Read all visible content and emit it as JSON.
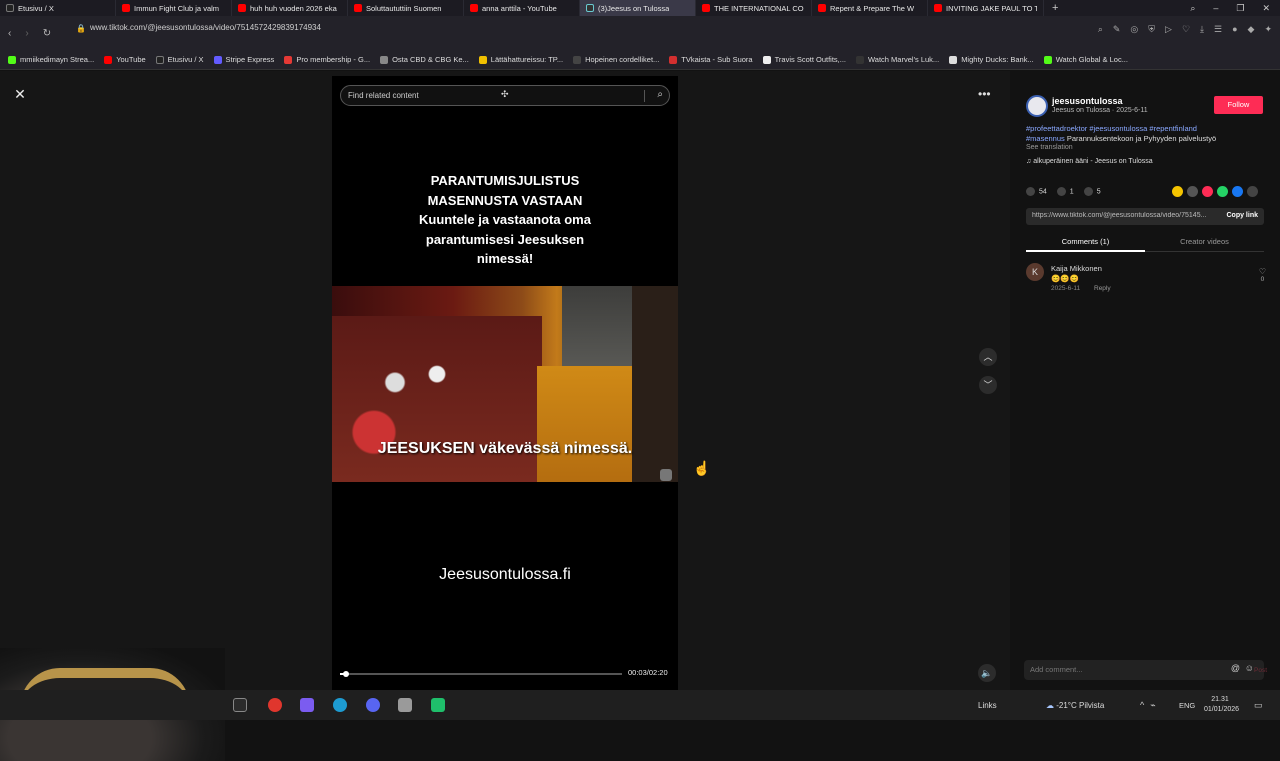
{
  "browser": {
    "tabs": [
      {
        "title": "Etusivu / X",
        "color": "#222222"
      },
      {
        "title": "Immun Fight Club ja valm",
        "color": "#ff0000"
      },
      {
        "title": "huh huh vuoden 2026 eka",
        "color": "#ff0000"
      },
      {
        "title": "Soluttaututtiin Suomen",
        "color": "#ff0000"
      },
      {
        "title": "anna anttila - YouTube",
        "color": "#ff0000"
      },
      {
        "title": "(3)Jeesus on Tulossa",
        "color": "#333333",
        "active": true
      },
      {
        "title": "THE INTERNATIONAL CO",
        "color": "#ff0000"
      },
      {
        "title": "Repent & Prepare The W",
        "color": "#ff0000"
      },
      {
        "title": "INVITING JAKE PAUL TO T",
        "color": "#ff0000"
      }
    ],
    "new_tab_label": "+",
    "url": "www.tiktok.com/@jeesusontulossa/video/7514572429839174934",
    "bookmarks": [
      {
        "label": "mmiikedimayn Strea...",
        "color": "#53fc18"
      },
      {
        "label": "YouTube",
        "color": "#ff0000"
      },
      {
        "label": "Etusivu / X",
        "color": "#222222"
      },
      {
        "label": "Stripe Express",
        "color": "#635bff"
      },
      {
        "label": "Pro membership - G...",
        "color": "#e53935"
      },
      {
        "label": "Osta CBD & CBG Ke...",
        "color": "#888888"
      },
      {
        "label": "Lättähattureissu: TP...",
        "color": "#f0c000"
      },
      {
        "label": "Hopeinen cordelliket...",
        "color": "#444444"
      },
      {
        "label": "TVkaista - Sub Suora",
        "color": "#d32f2f"
      },
      {
        "label": "Travis Scott Outfits,...",
        "color": "#eeeeee"
      },
      {
        "label": "Watch Marvel's Luk...",
        "color": "#333333"
      },
      {
        "label": "Mighty Ducks: Bank...",
        "color": "#dddddd"
      },
      {
        "label": "Watch Global & Loc...",
        "color": "#53fc18"
      }
    ]
  },
  "video": {
    "search_placeholder": "Find related content",
    "top_caption": [
      "PARANTUMISJULISTUS",
      "MASENNUSTA VASTAAN",
      "Kuuntele ja vastaanota oma",
      "parantumisesi Jeesuksen",
      "nimessä!"
    ],
    "scene_caption": "JEESUKSEN väkevässä nimessä.",
    "site_caption": "Jeesusontulossa.fi",
    "time": "00:03/02:20",
    "progress": 0.02
  },
  "panel": {
    "author": "jeesusontulossa",
    "author_sub": "Jeesus on Tulossa · 2025-6-11",
    "follow_label": "Follow",
    "desc_tags": "#profeettadroektor #jeesusontulossa #repentfinland",
    "desc_line2_tag": "#masennus",
    "desc_line2_text": " Parannuksentekoon ja Pyhyyden palvelustyö",
    "see_translation": "See translation",
    "sound": "♫ alkuperäinen ääni - Jeesus on Tulossa",
    "likes": "54",
    "comments_count": "1",
    "saves": "5",
    "share_colors": [
      "#f5c400",
      "#555555",
      "#fe2c55",
      "#25d366",
      "#1877f2",
      "#444444"
    ],
    "link_url": "https://www.tiktok.com/@jeesusontulossa/video/75145...",
    "copy_link": "Copy link",
    "tab_comments": "Comments (1)",
    "tab_creator": "Creator videos",
    "comment": {
      "initial": "K",
      "name": "Kaija Mikkonen",
      "emoji": "😊😊😊",
      "date": "2025-6-11",
      "reply": "Reply",
      "likes": "0"
    },
    "add_comment_placeholder": "Add comment...",
    "post_label": "Post"
  },
  "taskbar": {
    "links": "Links",
    "weather": "-21°C  Pilvista",
    "lang": "ENG",
    "time": "21.31",
    "date": "01/01/2026",
    "apps": [
      {
        "name": "task-view",
        "color": "#2b2b2b"
      },
      {
        "name": "opera",
        "color": "#e0362d"
      },
      {
        "name": "copilot",
        "color": "#7b5cf0"
      },
      {
        "name": "edge",
        "color": "#1d9bd1"
      },
      {
        "name": "discord",
        "color": "#5865f2"
      },
      {
        "name": "settings",
        "color": "#9a9a9a"
      },
      {
        "name": "sheets",
        "color": "#1fbf6b"
      }
    ]
  }
}
